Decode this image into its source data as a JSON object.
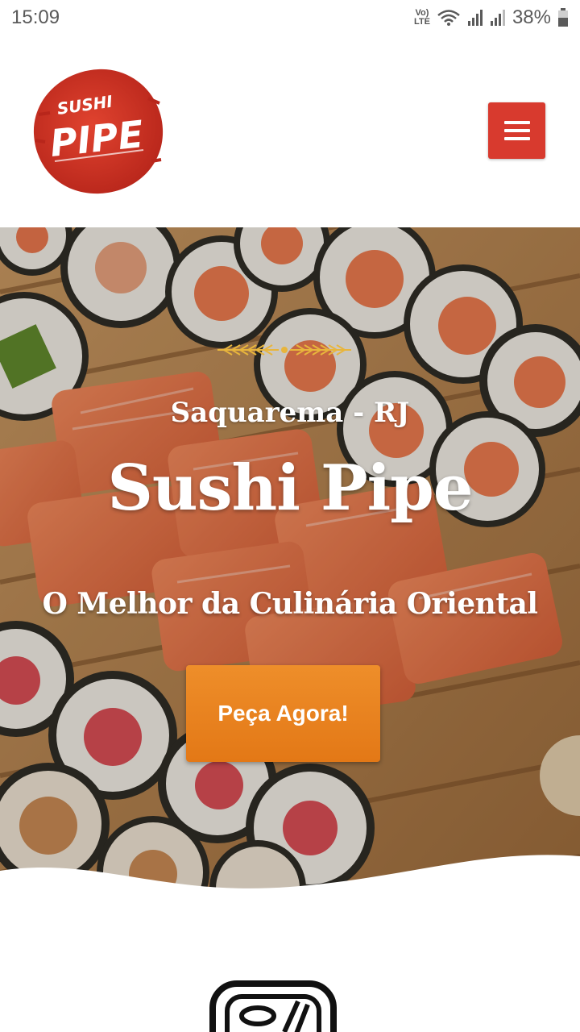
{
  "status_bar": {
    "time": "15:09",
    "volte_top": "Vo)",
    "volte_bottom": "LTE",
    "battery_percent": "38%"
  },
  "header": {
    "logo_top_text": "SUSHI",
    "logo_main_text": "PIPE",
    "menu_icon": "hamburger-icon",
    "menu_button_color": "#d83a2e"
  },
  "hero": {
    "location": "Saquarema - RJ",
    "title": "Sushi Pipe",
    "subtitle": "O Melhor da Culinária Oriental",
    "cta_label": "Peça Agora!",
    "cta_color": "#e8841f",
    "background_image": "sushi-rolls-photo"
  },
  "features": {
    "first_icon": "sushi-bowl-icon"
  }
}
